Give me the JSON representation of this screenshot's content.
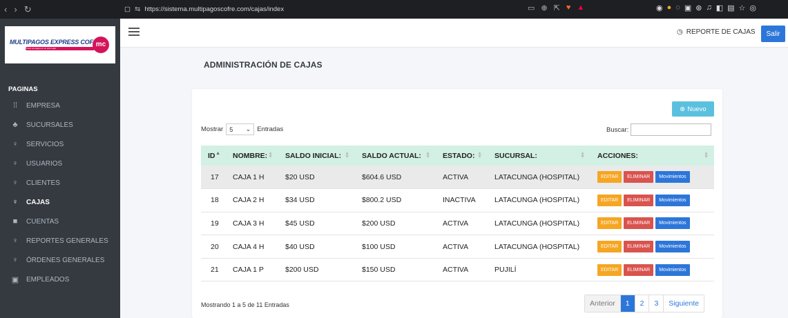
{
  "browser": {
    "url": "https://sistema.multipagoscofre.com/cajas/index"
  },
  "brand": {
    "name": "MULTIPAGOS EXPRESS COFRE",
    "tagline": "Todos tus pagos en un solo lugar",
    "badge": "mc"
  },
  "sidebar": {
    "section": "PAGINAS",
    "items": [
      {
        "label": "EMPRESA",
        "icon": "building-icon"
      },
      {
        "label": "SUCURSALES",
        "icon": "sitemap-icon"
      },
      {
        "label": "SERVICIOS",
        "icon": "user-icon"
      },
      {
        "label": "USUARIOS",
        "icon": "user-icon"
      },
      {
        "label": "CLIENTES",
        "icon": "user-icon"
      },
      {
        "label": "CAJAS",
        "icon": "user-icon"
      },
      {
        "label": "CUENTAS",
        "icon": "book-icon"
      },
      {
        "label": "REPORTES GENERALES",
        "icon": "user-icon"
      },
      {
        "label": "ÓRDENES GENERALES",
        "icon": "user-icon"
      },
      {
        "label": "EMPLEADOS",
        "icon": "id-card-icon"
      }
    ],
    "active": "CAJAS"
  },
  "topbar": {
    "report_label": "REPORTE DE CAJAS",
    "exit_label": "Salir"
  },
  "page": {
    "title": "ADMINISTRACIÓN DE CAJAS"
  },
  "controls": {
    "new_label": "Nuevo",
    "show_label": "Mostrar",
    "page_size": "5",
    "entries_label": "Entradas",
    "search_label": "Buscar:"
  },
  "table": {
    "headers": [
      "ID",
      "NOMBRE:",
      "SALDO INICIAL:",
      "SALDO ACTUAL:",
      "ESTADO:",
      "SUCURSAL:",
      "ACCIONES:"
    ],
    "rows": [
      {
        "id": "17",
        "name": "CAJA 1 H",
        "initial": "$20 USD",
        "current": "$604.6 USD",
        "status": "ACTIVA",
        "branch": "LATACUNGA (HOSPITAL)"
      },
      {
        "id": "18",
        "name": "CAJA 2 H",
        "initial": "$34 USD",
        "current": "$800.2 USD",
        "status": "INACTIVA",
        "branch": "LATACUNGA (HOSPITAL)"
      },
      {
        "id": "19",
        "name": "CAJA 3 H",
        "initial": "$45 USD",
        "current": "$200 USD",
        "status": "ACTIVA",
        "branch": "LATACUNGA (HOSPITAL)"
      },
      {
        "id": "20",
        "name": "CAJA 4 H",
        "initial": "$40 USD",
        "current": "$100 USD",
        "status": "ACTIVA",
        "branch": "LATACUNGA (HOSPITAL)"
      },
      {
        "id": "21",
        "name": "CAJA 1 P",
        "initial": "$200 USD",
        "current": "$150 USD",
        "status": "ACTIVA",
        "branch": "PUJILÍ"
      }
    ],
    "actions": {
      "edit": "EDITAR",
      "delete": "ELIMINAR",
      "movements": "Movimientos"
    }
  },
  "footer": {
    "info": "Mostrando 1 a 5 de 11 Entradas",
    "prev": "Anterior",
    "pages": [
      "1",
      "2",
      "3"
    ],
    "current_page": "1",
    "next": "Siguiente"
  },
  "colors": {
    "sidebar_bg": "#343a40",
    "header_row": "#d2f0e4",
    "primary": "#2d76d9",
    "edit": "#f5a623",
    "delete": "#d9534f",
    "new_button": "#5bc0de"
  }
}
